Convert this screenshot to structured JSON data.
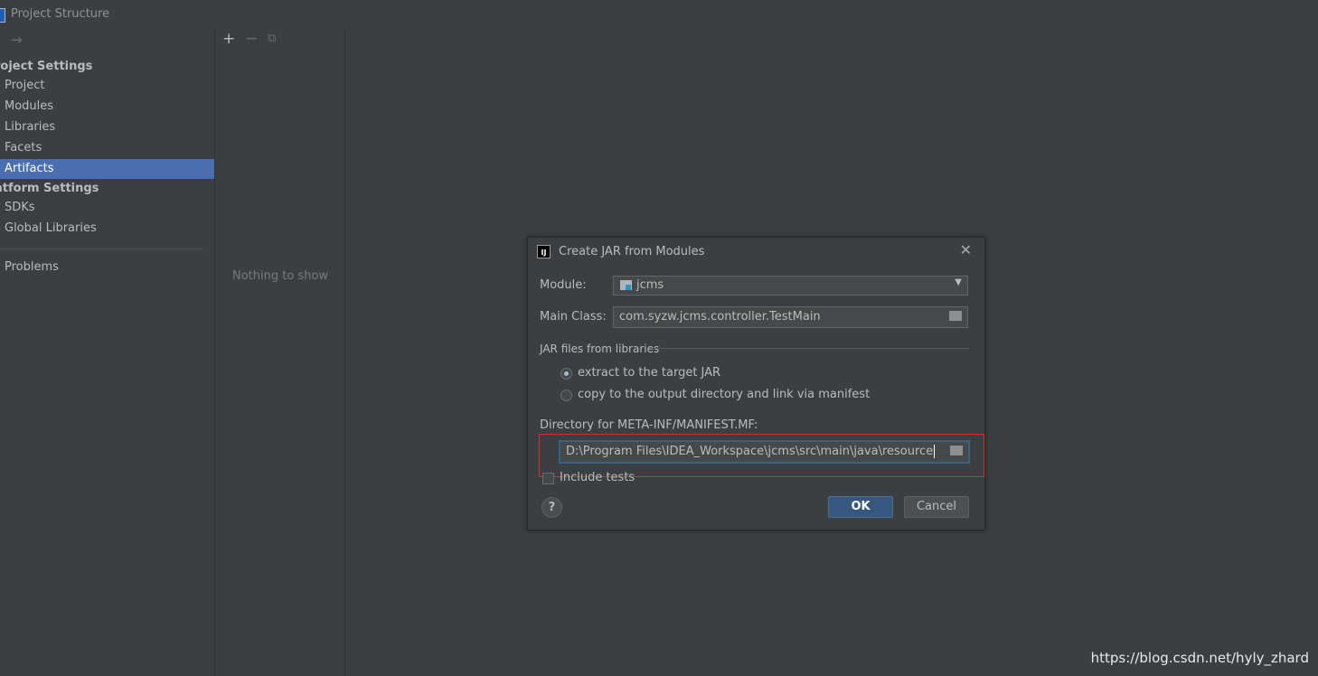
{
  "window": {
    "title": "Project Structure"
  },
  "sidebar": {
    "section_project": "roject Settings",
    "items_project": [
      "Project",
      "Modules",
      "Libraries",
      "Facets",
      "Artifacts"
    ],
    "section_platform": "atform Settings",
    "items_platform": [
      "SDKs",
      "Global Libraries"
    ],
    "problems": "Problems",
    "selected": "Artifacts"
  },
  "middle": {
    "empty_text": "Nothing to show"
  },
  "dialog": {
    "title": "Create JAR from Modules",
    "module_label": "Module:",
    "module_value": "jcms",
    "main_class_label": "Main Class:",
    "main_class_value": "com.syzw.jcms.controller.TestMain",
    "jar_group_label": "JAR files from libraries",
    "radio_extract": "extract to the target JAR",
    "radio_copy": "copy to the output directory and link via manifest",
    "radio_selected": "extract",
    "manifest_dir_label": "Directory for META-INF/MANIFEST.MF:",
    "manifest_dir_value": "D:\\Program Files\\IDEA_Workspace\\jcms\\src\\main\\java\\resource",
    "include_tests_label": "Include tests",
    "include_tests_checked": false,
    "ok_label": "OK",
    "cancel_label": "Cancel",
    "help_label": "?"
  },
  "watermark": "https://blog.csdn.net/hyly_zhard",
  "colors": {
    "selection": "#4b6eaf",
    "ok_button": "#365880",
    "highlight_box": "#d32f2f"
  }
}
